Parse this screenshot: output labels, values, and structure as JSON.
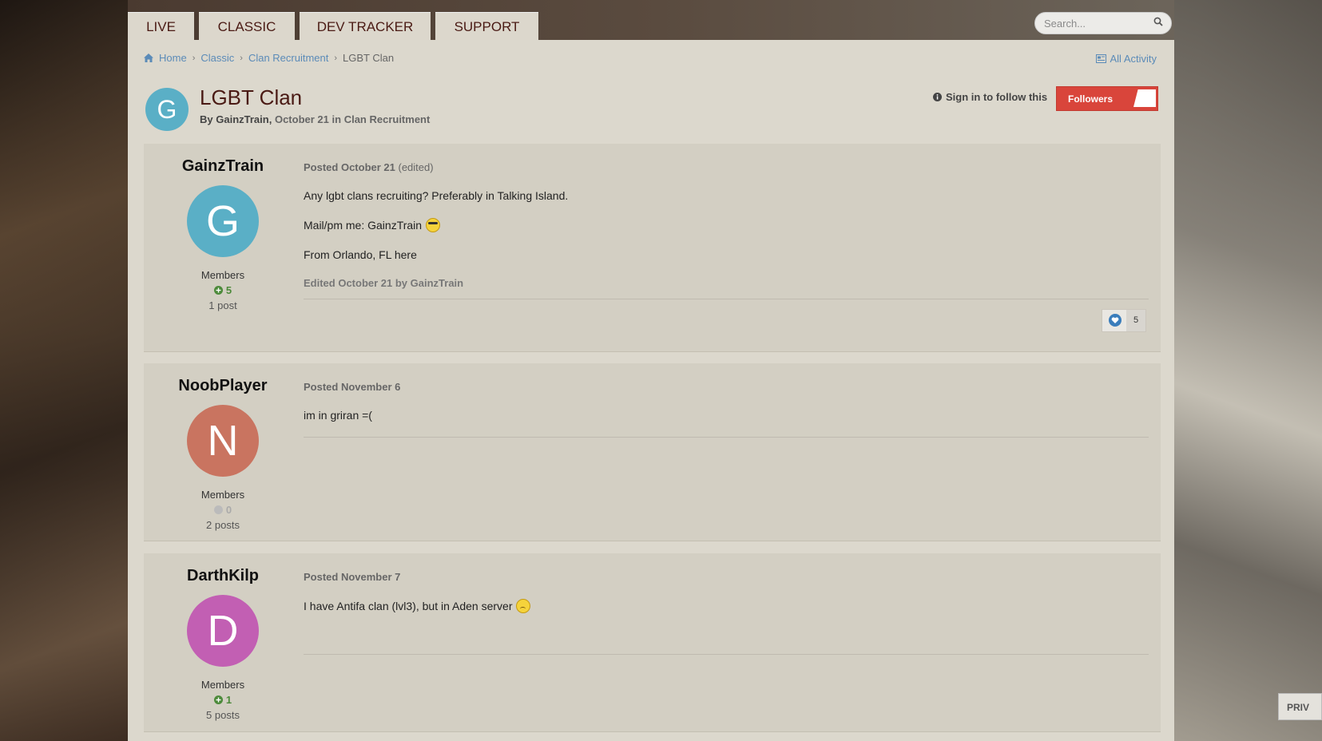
{
  "nav": {
    "tabs": [
      {
        "label": "LIVE"
      },
      {
        "label": "CLASSIC"
      },
      {
        "label": "DEV TRACKER"
      },
      {
        "label": "SUPPORT"
      }
    ]
  },
  "search": {
    "placeholder": "Search..."
  },
  "breadcrumb": {
    "home": "Home",
    "items": [
      "Classic",
      "Clan Recruitment"
    ],
    "current": "LGBT Clan"
  },
  "all_activity": "All Activity",
  "topic": {
    "avatar_letter": "G",
    "title": "LGBT Clan",
    "by": "By",
    "author": "GainzTrain",
    "date": "October 21",
    "in": "in",
    "forum": "Clan Recruitment",
    "sign_in_follow": "Sign in to follow this",
    "followers_label": "Followers"
  },
  "posts": [
    {
      "author": "GainzTrain",
      "avatar_letter": "G",
      "avatar_color": "#5aafc6",
      "group": "Members",
      "reputation": "5",
      "post_count": "1 post",
      "posted": "Posted October 21",
      "edited_tag": "(edited)",
      "body": [
        "Any lgbt clans recruiting? Preferably in Talking Island.",
        "Mail/pm me: GainzTrain",
        "From Orlando, FL here"
      ],
      "edited_note": "Edited October 21 by GainzTrain",
      "likes": "5"
    },
    {
      "author": "NoobPlayer",
      "avatar_letter": "N",
      "avatar_color": "#c97460",
      "group": "Members",
      "reputation": "0",
      "post_count": "2 posts",
      "posted": "Posted November 6",
      "body": [
        "im in griran =("
      ]
    },
    {
      "author": "DarthKilp",
      "avatar_letter": "D",
      "avatar_color": "#c25fb3",
      "group": "Members",
      "reputation": "1",
      "post_count": "5 posts",
      "posted": "Posted November 7",
      "body": [
        "I have Antifa clan (lvl3), but in Aden server"
      ]
    }
  ],
  "privacy_badge": "PRIV",
  "colors": {
    "title": "#4a1a14",
    "link": "#5b8bb8",
    "follow_button": "#d9453b",
    "reputation_positive": "#4c8a3a"
  }
}
